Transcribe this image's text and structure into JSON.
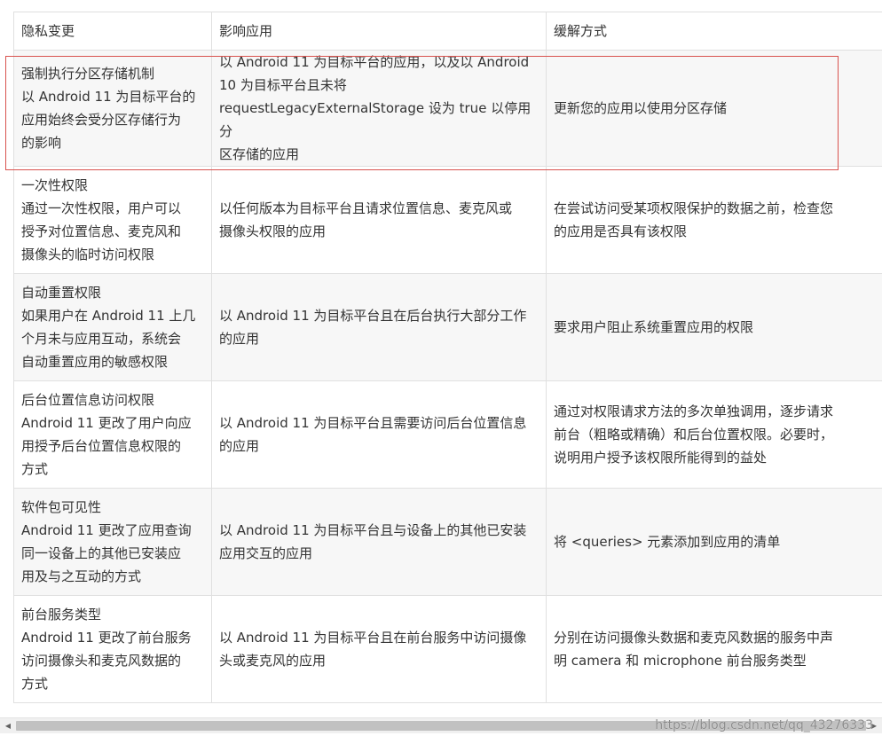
{
  "table": {
    "headers": [
      "隐私变更",
      "影响应用",
      "缓解方式"
    ],
    "rows": [
      {
        "change": [
          "强制执行分区存储机制",
          "以 Android 11 为目标平台的",
          "应用始终会受分区存储行为",
          "的影响"
        ],
        "affected": [
          "以 Android 11 为目标平台的应用，以及以 Android",
          "10 为目标平台且未将",
          "requestLegacyExternalStorage 设为 true 以停用分",
          "区存储的应用"
        ],
        "mitigation": [
          "更新您的应用以使用分区存储"
        ]
      },
      {
        "change": [
          "一次性权限",
          "通过一次性权限，用户可以",
          "授予对位置信息、麦克风和",
          "摄像头的临时访问权限"
        ],
        "affected": [
          "以任何版本为目标平台且请求位置信息、麦克风或",
          "摄像头权限的应用"
        ],
        "mitigation": [
          "在尝试访问受某项权限保护的数据之前，检查您",
          "的应用是否具有该权限"
        ]
      },
      {
        "change": [
          "自动重置权限",
          "如果用户在 Android 11 上几",
          "个月未与应用互动，系统会",
          "自动重置应用的敏感权限"
        ],
        "affected": [
          "以 Android 11 为目标平台且在后台执行大部分工作",
          "的应用"
        ],
        "mitigation": [
          "要求用户阻止系统重置应用的权限"
        ]
      },
      {
        "change": [
          "后台位置信息访问权限",
          "Android 11 更改了用户向应",
          "用授予后台位置信息权限的",
          "方式"
        ],
        "affected": [
          "以 Android 11 为目标平台且需要访问后台位置信息",
          "的应用"
        ],
        "mitigation": [
          "通过对权限请求方法的多次单独调用，逐步请求",
          "前台（粗略或精确）和后台位置权限。必要时，",
          "说明用户授予该权限所能得到的益处"
        ]
      },
      {
        "change": [
          "软件包可见性",
          "Android 11 更改了应用查询",
          "同一设备上的其他已安装应",
          "用及与之互动的方式"
        ],
        "affected": [
          "以 Android 11 为目标平台且与设备上的其他已安装",
          "应用交互的应用"
        ],
        "mitigation": [
          "将 <queries> 元素添加到应用的清单"
        ]
      },
      {
        "change": [
          "前台服务类型",
          "Android 11 更改了前台服务",
          "访问摄像头和麦克风数据的",
          "方式"
        ],
        "affected": [
          "以 Android 11 为目标平台且在前台服务中访问摄像",
          "头或麦克风的应用"
        ],
        "mitigation": [
          "分别在访问摄像头数据和麦克风数据的服务中声",
          "明 camera 和 microphone 前台服务类型"
        ]
      }
    ]
  },
  "highlight": {
    "color": "#d9534f"
  },
  "scrollbar": {
    "left_arrow_icon": "◀",
    "right_arrow_icon": "▶"
  },
  "watermark": "https://blog.csdn.net/qq_43276333"
}
